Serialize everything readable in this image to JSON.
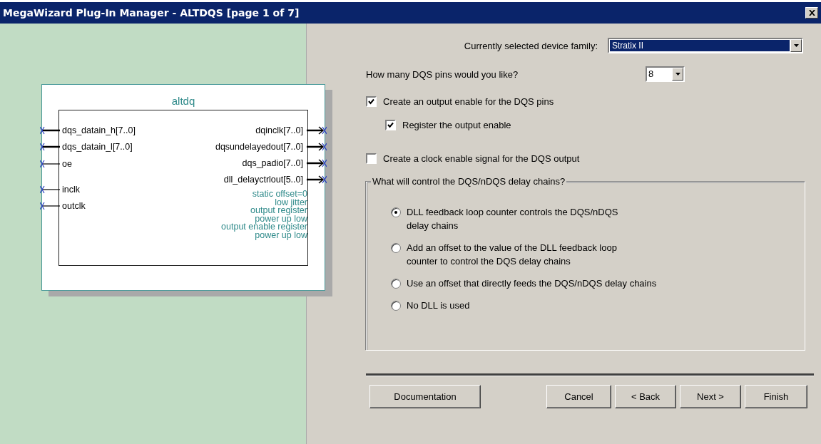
{
  "window": {
    "title": "MegaWizard Plug-In Manager - ALTDQS [page 1 of 7]"
  },
  "symbol": {
    "name": "altdq",
    "inputs": [
      {
        "label": "dqs_datain_h[7..0]",
        "bus": true
      },
      {
        "label": "dqs_datain_l[7..0]",
        "bus": true
      },
      {
        "label": "oe",
        "bus": false
      },
      {
        "label": "inclk",
        "bus": false
      },
      {
        "label": "outclk",
        "bus": false
      }
    ],
    "outputs": [
      {
        "label": "dqinclk[7..0]",
        "bus": true
      },
      {
        "label": "dqsundelayedout[7..0]",
        "bus": true
      },
      {
        "label": "dqs_padio[7..0]",
        "bus": true
      },
      {
        "label": "dll_delayctrlout[5..0]",
        "bus": true
      }
    ],
    "notes": [
      "static offset=0",
      "low jitter",
      "output register",
      "power up low",
      "output enable register",
      "power up low"
    ]
  },
  "device_family": {
    "label": "Currently selected device family:",
    "value": "Stratix II"
  },
  "dqs_pins": {
    "label": "How many DQS pins would you like?",
    "value": "8"
  },
  "options": [
    {
      "label": "Create an output enable for the DQS pins",
      "checked": true,
      "children": [
        {
          "label": "Register the output enable",
          "checked": true
        }
      ]
    },
    {
      "label": "Create a clock enable signal for the DQS output",
      "checked": false
    }
  ],
  "delay_control": {
    "legend": "What will control the DQS/nDQS delay chains?",
    "options": [
      {
        "label": "DLL feedback loop counter controls the DQS/nDQS\ndelay chains",
        "selected": true
      },
      {
        "label": "Add an offset to the value of the DLL feedback loop\ncounter to control the DQS delay chains",
        "selected": false
      },
      {
        "label": "Use an offset that directly feeds the DQS/nDQS delay chains",
        "selected": false
      },
      {
        "label": "No DLL is used",
        "selected": false
      }
    ]
  },
  "buttons": [
    {
      "label": "Documentation"
    },
    {
      "label": "Cancel"
    },
    {
      "label": "< Back"
    },
    {
      "label": "Next >"
    },
    {
      "label": "Finish"
    }
  ]
}
